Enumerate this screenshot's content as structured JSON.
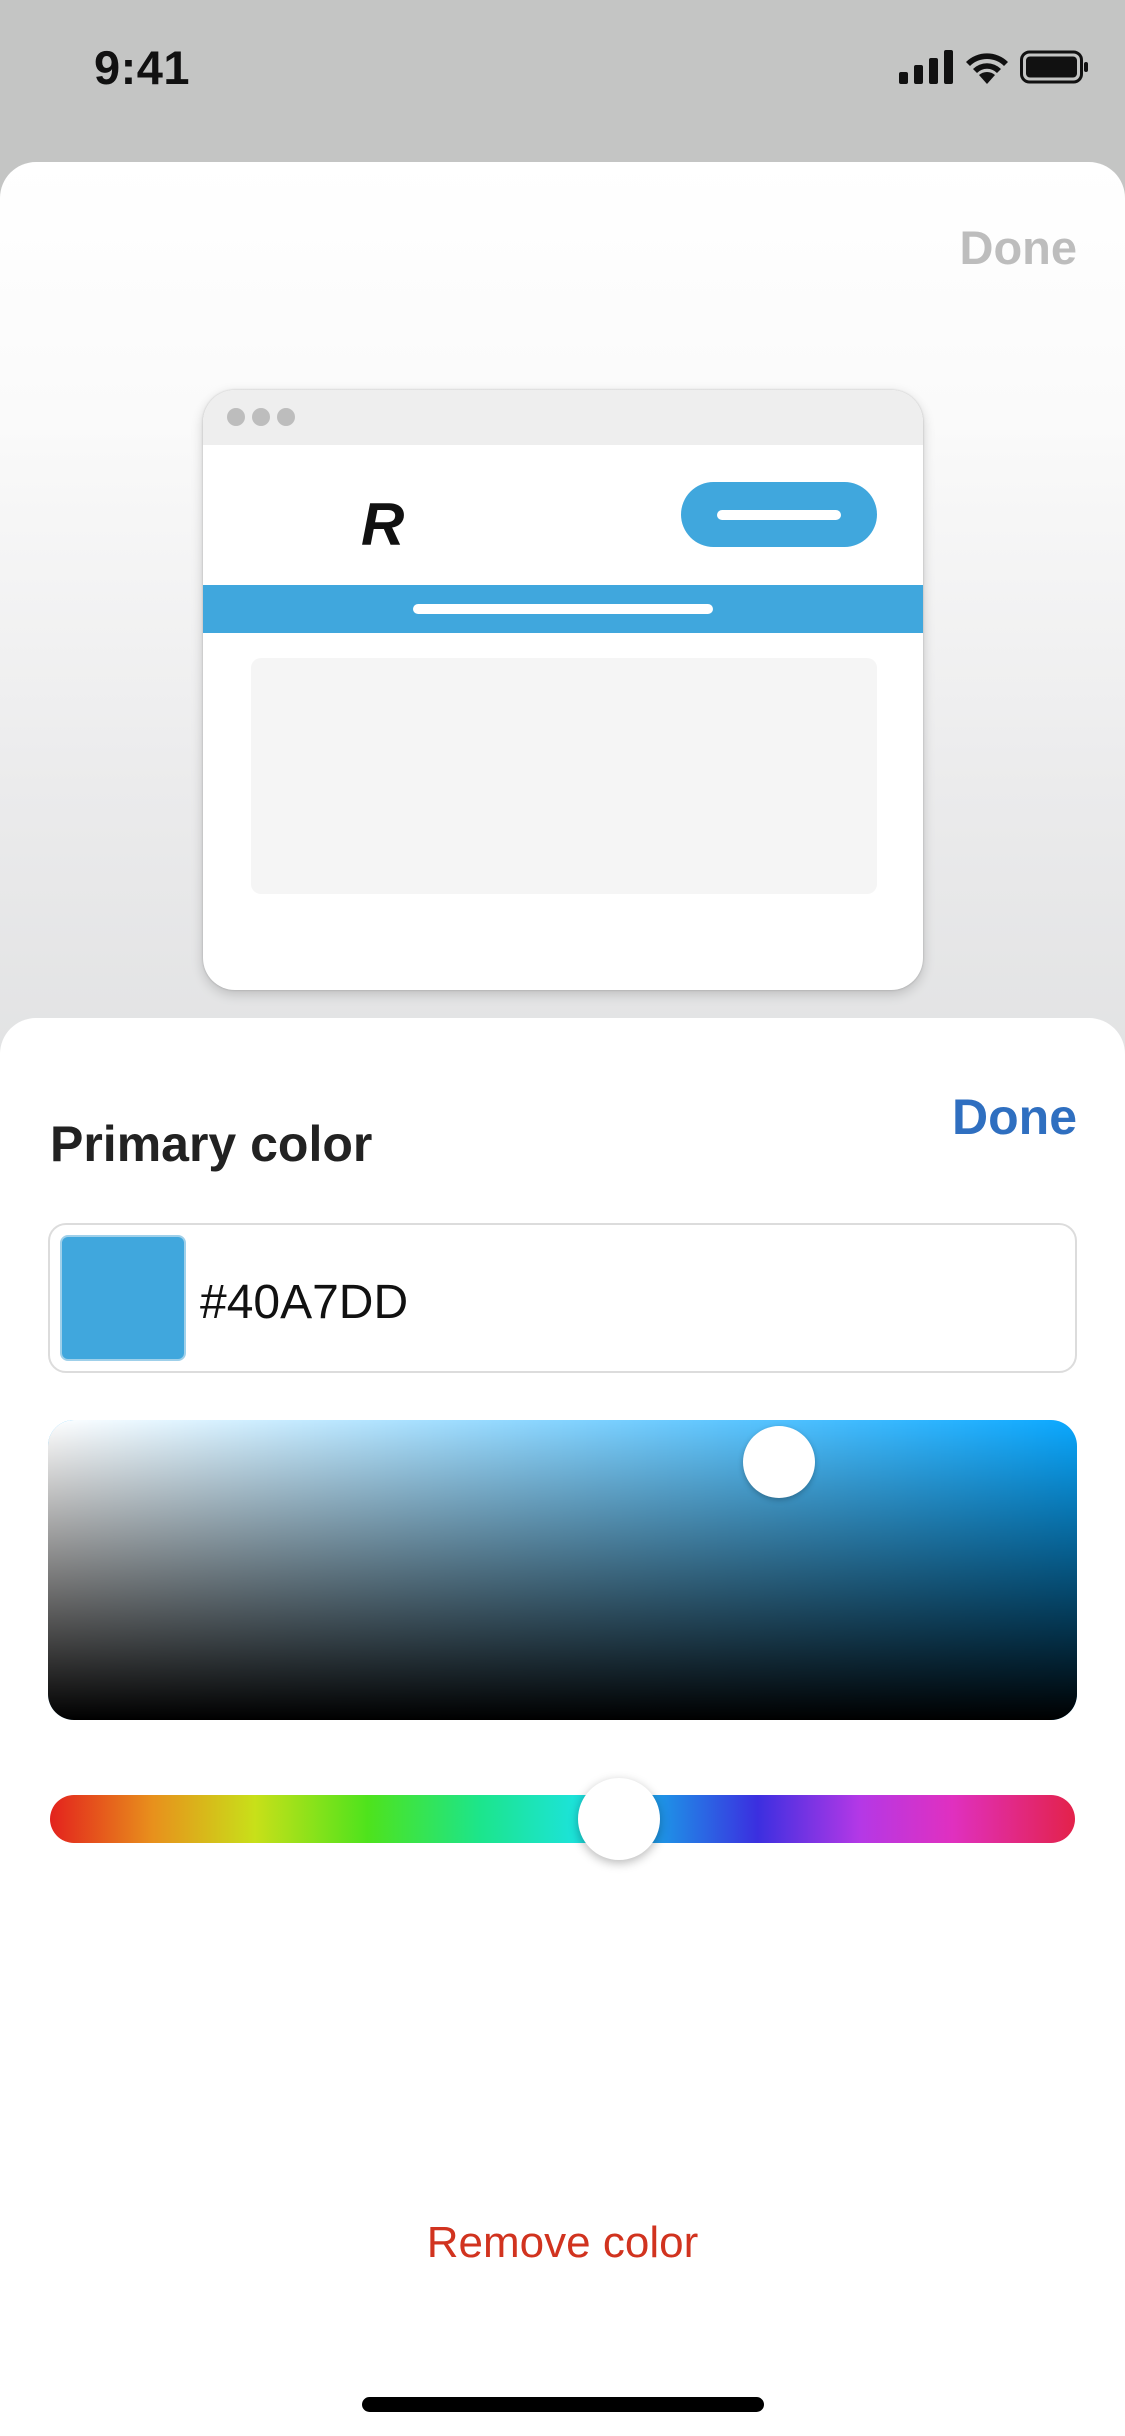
{
  "status_bar": {
    "time": "9:41"
  },
  "preview_sheet": {
    "done_label": "Done",
    "logo_letter": "R",
    "accent_color": "#40A7DD"
  },
  "color_sheet": {
    "title": "Primary color",
    "done_label": "Done",
    "hex_value": "#40A7DD",
    "swatch_color": "#40A7DD",
    "picker_base_hue_color": "#0AA8FF",
    "saturation_fraction": 0.71,
    "brightness_fraction": 0.86,
    "hue_fraction": 0.555,
    "remove_label": "Remove color"
  },
  "colors": {
    "done_disabled": "#BDBDBD",
    "done_active": "#2F6FC0",
    "destructive": "#D1331F"
  }
}
